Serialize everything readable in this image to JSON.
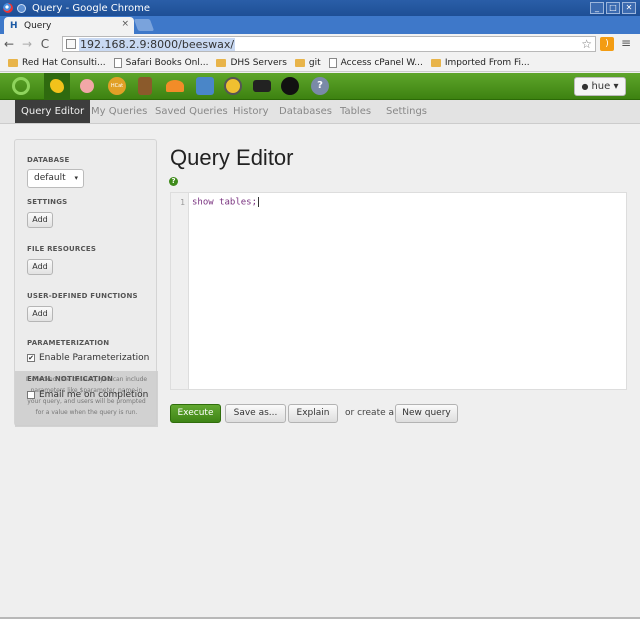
{
  "window": {
    "title": "Query - Google Chrome",
    "controls": [
      "_",
      "□",
      "✕"
    ]
  },
  "tab": {
    "title": "Query",
    "favicon": "H",
    "close": "×"
  },
  "toolbar": {
    "back": "←",
    "forward": "→",
    "reload": "C",
    "url": "192.168.2.9:8000/beeswax/",
    "star": "☆",
    "menu": "≡"
  },
  "bookmarks": [
    {
      "label": "Red Hat Consulti...",
      "type": "folder"
    },
    {
      "label": "Safari Books Onl...",
      "type": "page"
    },
    {
      "label": "DHS Servers",
      "type": "folder"
    },
    {
      "label": "git",
      "type": "folder"
    },
    {
      "label": "Access cPanel W...",
      "type": "page"
    },
    {
      "label": "Imported From Fi...",
      "type": "folder"
    }
  ],
  "hue": {
    "user": "hue ▾",
    "apps": [
      {
        "name": "hue-home-icon",
        "color": "#5fb332"
      },
      {
        "name": "beeswax-bee-icon",
        "color": "#f2c21b"
      },
      {
        "name": "pig-icon",
        "color": "#f0a0a0"
      },
      {
        "name": "hcat-icon",
        "color": "#e1a026"
      },
      {
        "name": "file-browser-icon",
        "color": "#8b5a2b"
      },
      {
        "name": "job-designer-icon",
        "color": "#f28c28"
      },
      {
        "name": "oozie-icon",
        "color": "#4a86c8"
      },
      {
        "name": "job-browser-icon",
        "color": "#f0c030"
      },
      {
        "name": "shell-icon",
        "color": "#222222"
      },
      {
        "name": "hbase-icon",
        "color": "#111111"
      },
      {
        "name": "help-icon",
        "color": "#7a8aa8"
      }
    ]
  },
  "subnav": [
    {
      "label": "Query Editor",
      "active": true
    },
    {
      "label": "My Queries"
    },
    {
      "label": "Saved Queries"
    },
    {
      "label": "History"
    },
    {
      "label": "Databases"
    },
    {
      "label": "Tables"
    },
    {
      "label": "Settings"
    }
  ],
  "sidebar": {
    "database_label": "DATABASE",
    "database_value": "default",
    "database_caret": "▾",
    "settings_label": "SETTINGS",
    "file_resources_label": "FILE RESOURCES",
    "udf_label": "USER-DEFINED FUNCTIONS",
    "add_label": "Add",
    "parameterization_label": "PARAMETERIZATION",
    "enable_parameterization": "Enable Parameterization",
    "email_notification_label": "EMAIL NOTIFICATION",
    "email_me": "Email me on completion",
    "checkmark": "✔",
    "tooltip": "If checked (the default), you can include parameters like $parameter_name in your query, and users will be prompted for a value when the query is run."
  },
  "main": {
    "title": "Query Editor",
    "help": "?",
    "line_number": "1",
    "query": "show tables;",
    "execute": "Execute",
    "save_as": "Save as...",
    "explain": "Explain",
    "or_create": "or create a",
    "new_query": "New query"
  },
  "colors": {
    "hue_green": "#4a9420",
    "active_tab": "#3d3d3d",
    "keyword": "#7a3380"
  }
}
